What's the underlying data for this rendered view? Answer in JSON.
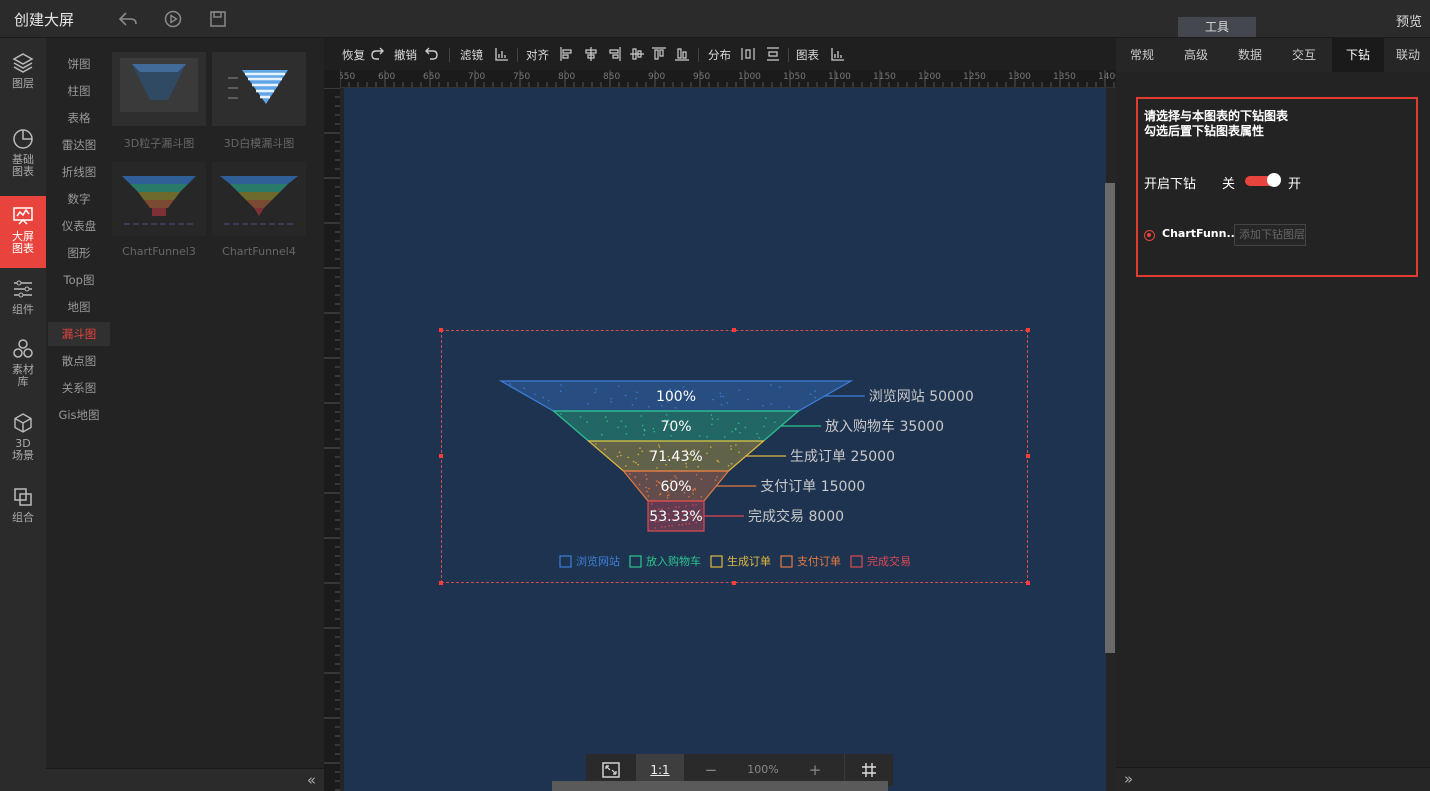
{
  "topbar": {
    "title": "创建大屏",
    "tools_tab": "工具",
    "preview": "预览"
  },
  "leftnav": [
    {
      "label": "图层",
      "icon": "layers-icon"
    },
    {
      "label": "基础\n图表",
      "icon": "pie-icon"
    },
    {
      "label": "大屏\n图表",
      "icon": "bigscreen-icon",
      "active": true
    },
    {
      "label": "组件",
      "icon": "sliders-icon"
    },
    {
      "label": "素材\n库",
      "icon": "material-icon"
    },
    {
      "label": "3D\n场景",
      "icon": "cube-icon"
    },
    {
      "label": "组合",
      "icon": "group-icon"
    }
  ],
  "categories": [
    "饼图",
    "柱图",
    "表格",
    "雷达图",
    "折线图",
    "数字",
    "仪表盘",
    "图形",
    "Top图",
    "地图",
    "漏斗图",
    "散点图",
    "关系图",
    "Gis地图"
  ],
  "active_category": "漏斗图",
  "thumbnails": [
    {
      "caption": "3D粒子漏斗图"
    },
    {
      "caption": "3D白模漏斗图"
    },
    {
      "caption": "ChartFunnel3"
    },
    {
      "caption": "ChartFunnel4"
    }
  ],
  "toolbar": {
    "redo": "恢复",
    "undo": "撤销",
    "filter": "滤镜",
    "align": "对齐",
    "distribute": "分布",
    "chart": "图表"
  },
  "ruler": {
    "h_ticks": [
      "550",
      "600",
      "650",
      "700",
      "750",
      "800",
      "850",
      "900",
      "950",
      "1000",
      "1050",
      "1100",
      "1150",
      "1200",
      "1250",
      "1300",
      "1350",
      "1400"
    ]
  },
  "funnel": {
    "stages": [
      {
        "name": "浏览网站",
        "value": 50000,
        "percent": "100%",
        "color": "#3d7fd9"
      },
      {
        "name": "放入购物车",
        "value": 35000,
        "percent": "70%",
        "color": "#2bc58f"
      },
      {
        "name": "生成订单",
        "value": 25000,
        "percent": "71.43%",
        "color": "#e0b93e"
      },
      {
        "name": "支付订单",
        "value": 15000,
        "percent": "60%",
        "color": "#e47a44"
      },
      {
        "name": "完成交易",
        "value": 8000,
        "percent": "53.33%",
        "color": "#dd4a52"
      }
    ]
  },
  "zoombar": {
    "fit": "fit-screen-icon",
    "one_to_one": "1:1",
    "minus": "−",
    "zoom": "100%",
    "plus": "+",
    "grid": "grid-icon"
  },
  "rightpanel": {
    "tabs": [
      "常规",
      "高级",
      "数据",
      "交互",
      "下钻",
      "联动"
    ],
    "active_tab": "下钻",
    "desc_line1": "请选择与本图表的下钻图表",
    "desc_line2": "勾选后置下钻图表属性",
    "drill_label": "开启下钻",
    "off_label": "关",
    "on_label": "开",
    "chart_name": "ChartFunn...",
    "layer_placeholder": "添加下钻图层"
  }
}
